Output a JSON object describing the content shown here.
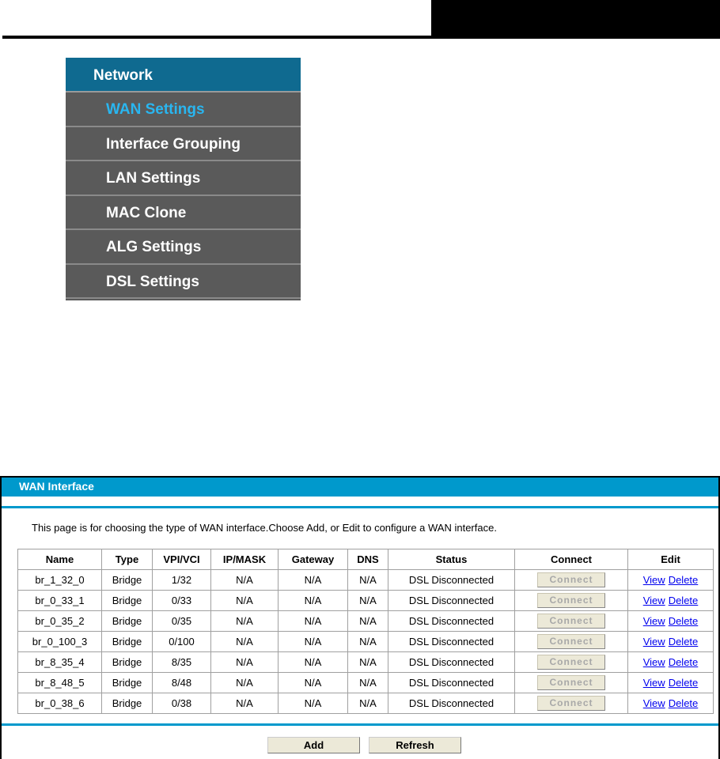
{
  "menu": {
    "header": "Network",
    "items": [
      {
        "label": "WAN Settings",
        "active": true
      },
      {
        "label": "Interface Grouping"
      },
      {
        "label": "LAN Settings"
      },
      {
        "label": "MAC Clone"
      },
      {
        "label": "ALG Settings"
      },
      {
        "label": "DSL Settings"
      }
    ]
  },
  "panel": {
    "title": "WAN Interface",
    "description": "This page is for choosing the type of WAN interface.Choose Add, or Edit to configure a WAN interface.",
    "columns": [
      "Name",
      "Type",
      "VPI/VCI",
      "IP/MASK",
      "Gateway",
      "DNS",
      "Status",
      "Connect",
      "Edit"
    ],
    "rows": [
      {
        "name": "br_1_32_0",
        "type": "Bridge",
        "vpivci": "1/32",
        "ipmask": "N/A",
        "gateway": "N/A",
        "dns": "N/A",
        "status": "DSL Disconnected",
        "connect": "Connect",
        "view": "View",
        "delete": "Delete"
      },
      {
        "name": "br_0_33_1",
        "type": "Bridge",
        "vpivci": "0/33",
        "ipmask": "N/A",
        "gateway": "N/A",
        "dns": "N/A",
        "status": "DSL Disconnected",
        "connect": "Connect",
        "view": "View",
        "delete": "Delete"
      },
      {
        "name": "br_0_35_2",
        "type": "Bridge",
        "vpivci": "0/35",
        "ipmask": "N/A",
        "gateway": "N/A",
        "dns": "N/A",
        "status": "DSL Disconnected",
        "connect": "Connect",
        "view": "View",
        "delete": "Delete"
      },
      {
        "name": "br_0_100_3",
        "type": "Bridge",
        "vpivci": "0/100",
        "ipmask": "N/A",
        "gateway": "N/A",
        "dns": "N/A",
        "status": "DSL Disconnected",
        "connect": "Connect",
        "view": "View",
        "delete": "Delete"
      },
      {
        "name": "br_8_35_4",
        "type": "Bridge",
        "vpivci": "8/35",
        "ipmask": "N/A",
        "gateway": "N/A",
        "dns": "N/A",
        "status": "DSL Disconnected",
        "connect": "Connect",
        "view": "View",
        "delete": "Delete"
      },
      {
        "name": "br_8_48_5",
        "type": "Bridge",
        "vpivci": "8/48",
        "ipmask": "N/A",
        "gateway": "N/A",
        "dns": "N/A",
        "status": "DSL Disconnected",
        "connect": "Connect",
        "view": "View",
        "delete": "Delete"
      },
      {
        "name": "br_0_38_6",
        "type": "Bridge",
        "vpivci": "0/38",
        "ipmask": "N/A",
        "gateway": "N/A",
        "dns": "N/A",
        "status": "DSL Disconnected",
        "connect": "Connect",
        "view": "View",
        "delete": "Delete"
      }
    ],
    "add_label": "Add",
    "refresh_label": "Refresh"
  }
}
